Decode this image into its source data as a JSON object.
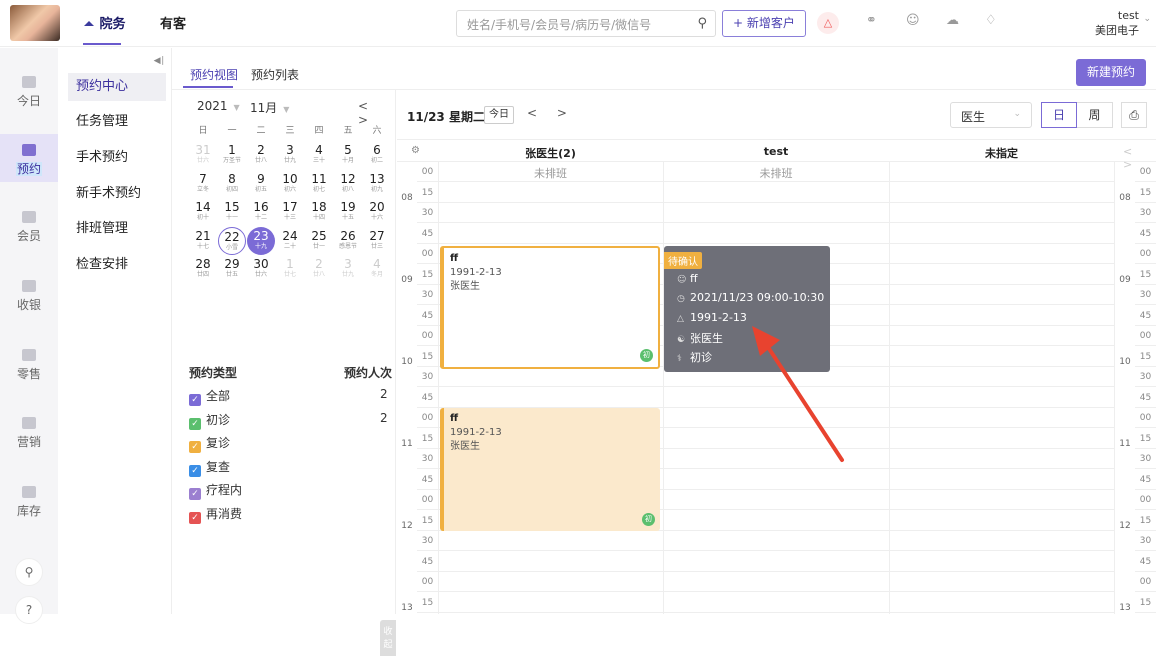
{
  "topbar": {
    "nav_primary": "院务",
    "nav_secondary": "有客",
    "search_placeholder": "姓名/手机号/会员号/病历号/微信号",
    "add_customer": "新增客户",
    "user_name": "test",
    "user_org": "美团电子"
  },
  "leftnav": [
    {
      "label": "今日"
    },
    {
      "label": "预约"
    },
    {
      "label": "会员"
    },
    {
      "label": "收银"
    },
    {
      "label": "零售"
    },
    {
      "label": "营销"
    },
    {
      "label": "库存"
    }
  ],
  "subnav": [
    "预约中心",
    "任务管理",
    "手术预约",
    "新手术预约",
    "排班管理",
    "检查安排"
  ],
  "tabs": [
    "预约视图",
    "预约列表"
  ],
  "new_appt_button": "新建预约",
  "calendar": {
    "year": "2021",
    "month": "11月",
    "weekdays": [
      "日",
      "一",
      "二",
      "三",
      "四",
      "五",
      "六"
    ],
    "days": [
      {
        "n": "31",
        "l": "廿六",
        "o": true
      },
      {
        "n": "1",
        "l": "万圣节"
      },
      {
        "n": "2",
        "l": "廿八"
      },
      {
        "n": "3",
        "l": "廿九"
      },
      {
        "n": "4",
        "l": "三十"
      },
      {
        "n": "5",
        "l": "十月"
      },
      {
        "n": "6",
        "l": "初二"
      },
      {
        "n": "7",
        "l": "立冬"
      },
      {
        "n": "8",
        "l": "初四"
      },
      {
        "n": "9",
        "l": "初五"
      },
      {
        "n": "10",
        "l": "初六"
      },
      {
        "n": "11",
        "l": "初七"
      },
      {
        "n": "12",
        "l": "初八"
      },
      {
        "n": "13",
        "l": "初九"
      },
      {
        "n": "14",
        "l": "初十"
      },
      {
        "n": "15",
        "l": "十一"
      },
      {
        "n": "16",
        "l": "十二"
      },
      {
        "n": "17",
        "l": "十三"
      },
      {
        "n": "18",
        "l": "十四"
      },
      {
        "n": "19",
        "l": "十五"
      },
      {
        "n": "20",
        "l": "十六"
      },
      {
        "n": "21",
        "l": "十七"
      },
      {
        "n": "22",
        "l": "小雪",
        "today": true
      },
      {
        "n": "23",
        "l": "十九",
        "sel": true
      },
      {
        "n": "24",
        "l": "二十"
      },
      {
        "n": "25",
        "l": "廿一"
      },
      {
        "n": "26",
        "l": "感恩节"
      },
      {
        "n": "27",
        "l": "廿三"
      },
      {
        "n": "28",
        "l": "廿四"
      },
      {
        "n": "29",
        "l": "廿五"
      },
      {
        "n": "30",
        "l": "廿六"
      },
      {
        "n": "1",
        "l": "廿七",
        "o": true
      },
      {
        "n": "2",
        "l": "廿八",
        "o": true
      },
      {
        "n": "3",
        "l": "廿九",
        "o": true
      },
      {
        "n": "4",
        "l": "冬月",
        "o": true
      }
    ]
  },
  "types": {
    "header": "预约类型",
    "count_header": "预约人次",
    "items": [
      {
        "label": "全部",
        "color": "#7b6bd6",
        "count": "2"
      },
      {
        "label": "初诊",
        "color": "#5bbf6e",
        "count": "2"
      },
      {
        "label": "复诊",
        "color": "#f0b040",
        "count": ""
      },
      {
        "label": "复查",
        "color": "#3a8ee6",
        "count": ""
      },
      {
        "label": "疗程内",
        "color": "#9b7fd0",
        "count": ""
      },
      {
        "label": "再消费",
        "color": "#e55353",
        "count": ""
      }
    ]
  },
  "collapse_label": "收起",
  "schedule": {
    "date_title": "11/23 星期二",
    "today_button": "今日",
    "doctor_filter": "医生",
    "view_day": "日",
    "view_week": "周",
    "columns": [
      "张医生(2)",
      "test",
      "未指定"
    ],
    "unscheduled": "未排班",
    "minutes": [
      "00",
      "15",
      "30",
      "45"
    ],
    "hours": [
      "08",
      "09",
      "10",
      "11",
      "12",
      "13"
    ]
  },
  "appointments": [
    {
      "name": "ff",
      "birthday": "1991-2-13",
      "doctor": "张医生",
      "badge": "初"
    },
    {
      "name": "ff",
      "birthday": "1991-2-13",
      "doctor": "张医生",
      "badge": "初"
    }
  ],
  "popup": {
    "status": "待确认",
    "name": "ff",
    "time": "2021/11/23 09:00-10:30",
    "birthday": "1991-2-13",
    "doctor": "张医生",
    "type": "初诊"
  },
  "colors": {
    "accent": "#7b6bd6",
    "pending": "#f0b040",
    "first_visit": "#5bbf6e",
    "annotation_arrow": "#e8432f"
  }
}
